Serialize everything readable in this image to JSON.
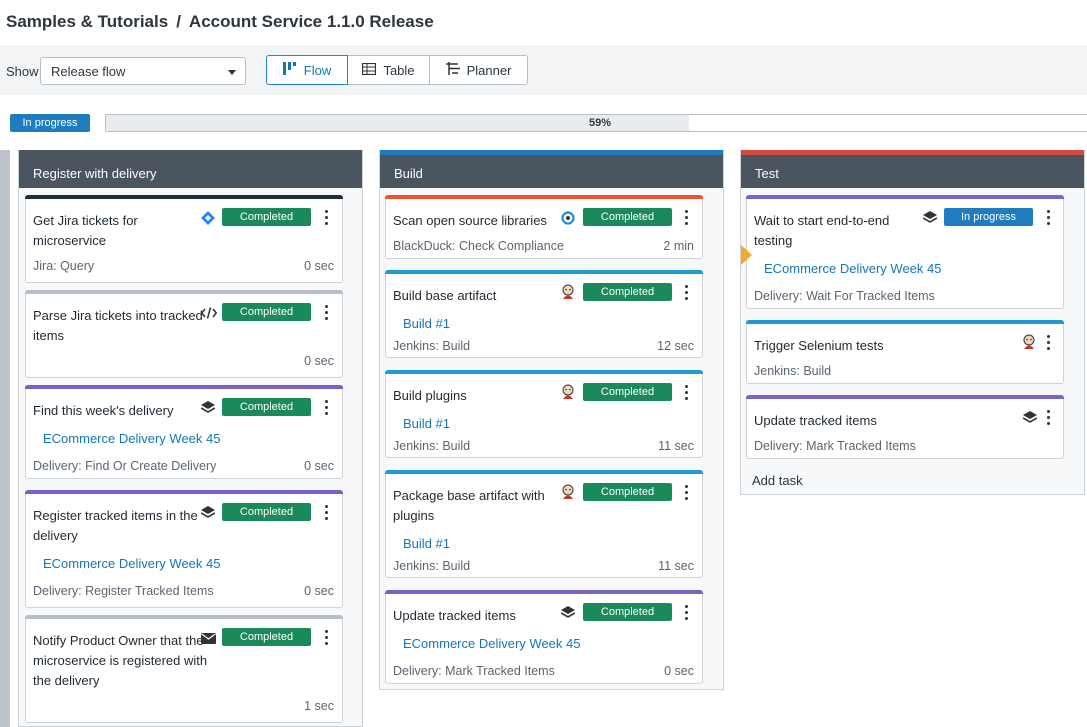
{
  "breadcrumb": {
    "parent": "Samples & Tutorials",
    "separator": "/",
    "current": "Account Service 1.1.0 Release"
  },
  "toolbar": {
    "show_label": "Show",
    "show_value": "Release flow",
    "views": [
      {
        "label": "Flow",
        "icon": "flow-icon",
        "active": true
      },
      {
        "label": "Table",
        "icon": "table-icon"
      },
      {
        "label": "Planner",
        "icon": "planner-icon"
      }
    ]
  },
  "release": {
    "status": "In progress",
    "progress_text": "59%",
    "progress": 0.59
  },
  "columns": [
    {
      "title": "Register with delivery",
      "accent": "#4a5560",
      "tasks": [
        {
          "title": "Get Jira tickets for microservice",
          "icon": "jira-diamond-icon",
          "status": "Completed",
          "source": "Jira: Query",
          "duration": "0 sec",
          "bar": "#1d2d3a"
        },
        {
          "title": "Parse Jira tickets into tracked items",
          "icon": "code-icon",
          "status": "Completed",
          "source": "",
          "duration": "0 sec",
          "bar": "#b8bec6"
        },
        {
          "title": "Find this week's delivery",
          "icon": "layers-icon",
          "status": "Completed",
          "link": "ECommerce Delivery Week 45",
          "source": "Delivery: Find Or Create Delivery",
          "duration": "0 sec",
          "bar": "#7b61c9"
        },
        {
          "title": "Register tracked items in the delivery",
          "icon": "layers-icon",
          "status": "Completed",
          "link": "ECommerce Delivery Week 45",
          "source": "Delivery: Register Tracked Items",
          "duration": "0 sec",
          "bar": "#7b61c9"
        },
        {
          "title": "Notify Product Owner that the microservice is registered with the delivery",
          "icon": "mail-icon",
          "status": "Completed",
          "source": "",
          "duration": "1 sec",
          "bar": "#b8bec6"
        }
      ]
    },
    {
      "title": "Build",
      "accent": "#1f7cbf",
      "tasks": [
        {
          "title": "Scan open source libraries",
          "icon": "blackduck-icon",
          "status": "Completed",
          "source": "BlackDuck: Check Compliance",
          "duration": "2 min",
          "bar": "#f2542d"
        },
        {
          "title": "Build base artifact",
          "icon": "jenkins-icon",
          "status": "Completed",
          "link": "Build #1",
          "source": "Jenkins: Build",
          "duration": "12 sec",
          "bar": "#1f9ad6"
        },
        {
          "title": "Build plugins",
          "icon": "jenkins-icon",
          "status": "Completed",
          "link": "Build #1",
          "source": "Jenkins: Build",
          "duration": "11 sec",
          "bar": "#1f9ad6"
        },
        {
          "title": "Package base artifact with plugins",
          "icon": "jenkins-icon",
          "status": "Completed",
          "link": "Build #1",
          "source": "Jenkins: Build",
          "duration": "11 sec",
          "bar": "#1f9ad6"
        },
        {
          "title": "Update tracked items",
          "icon": "layers-icon",
          "status": "Completed",
          "link": "ECommerce Delivery Week 45",
          "source": "Delivery: Mark Tracked Items",
          "duration": "0 sec",
          "bar": "#7b61c9"
        }
      ]
    },
    {
      "title": "Test",
      "accent": "#d14b3f",
      "tasks": [
        {
          "title": "Wait to start end-to-end testing",
          "icon": "layers-icon",
          "status": "In progress",
          "link": "ECommerce Delivery Week 45",
          "source": "Delivery: Wait For Tracked Items",
          "bar": "#7b61c9"
        },
        {
          "title": "Trigger Selenium tests",
          "icon": "jenkins-icon",
          "source": "Jenkins: Build",
          "bar": "#1f9ad6"
        },
        {
          "title": "Update tracked items",
          "icon": "layers-icon",
          "source": "Delivery: Mark Tracked Items",
          "bar": "#7b61c9"
        }
      ],
      "add_task": "Add task"
    }
  ]
}
